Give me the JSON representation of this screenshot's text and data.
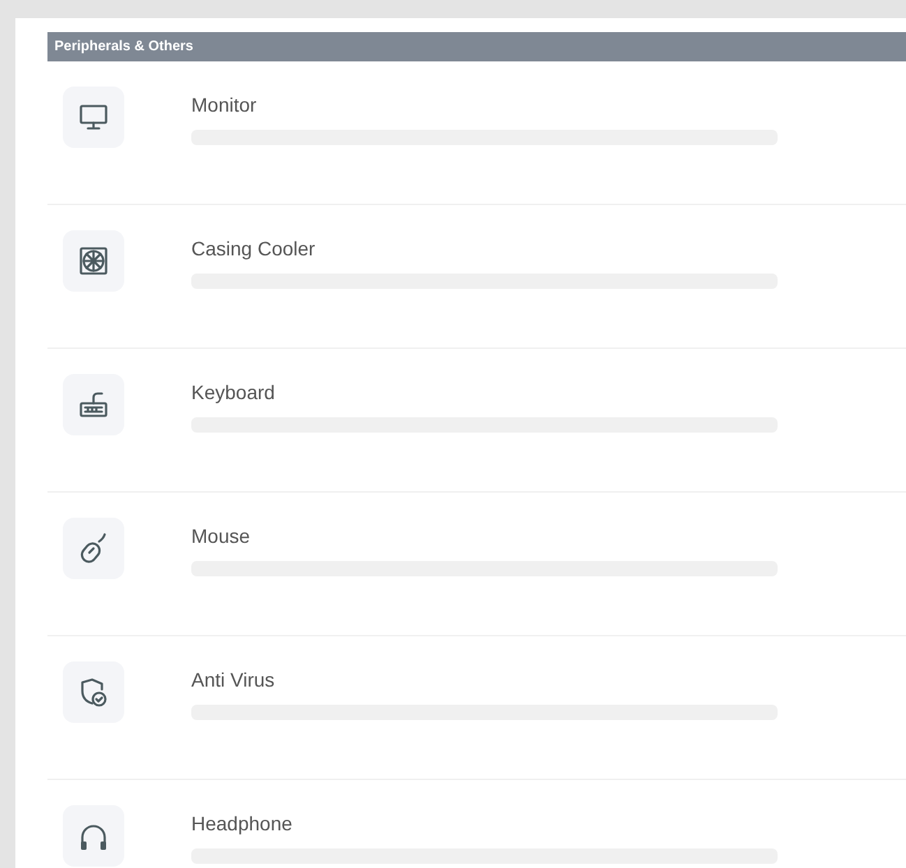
{
  "section": {
    "title": "Peripherals & Others"
  },
  "items": [
    {
      "kind": "monitor",
      "label": "Monitor"
    },
    {
      "kind": "cooler",
      "label": "Casing Cooler"
    },
    {
      "kind": "keyboard",
      "label": "Keyboard"
    },
    {
      "kind": "mouse",
      "label": "Mouse"
    },
    {
      "kind": "antivirus",
      "label": "Anti Virus"
    },
    {
      "kind": "headphone",
      "label": "Headphone"
    }
  ]
}
